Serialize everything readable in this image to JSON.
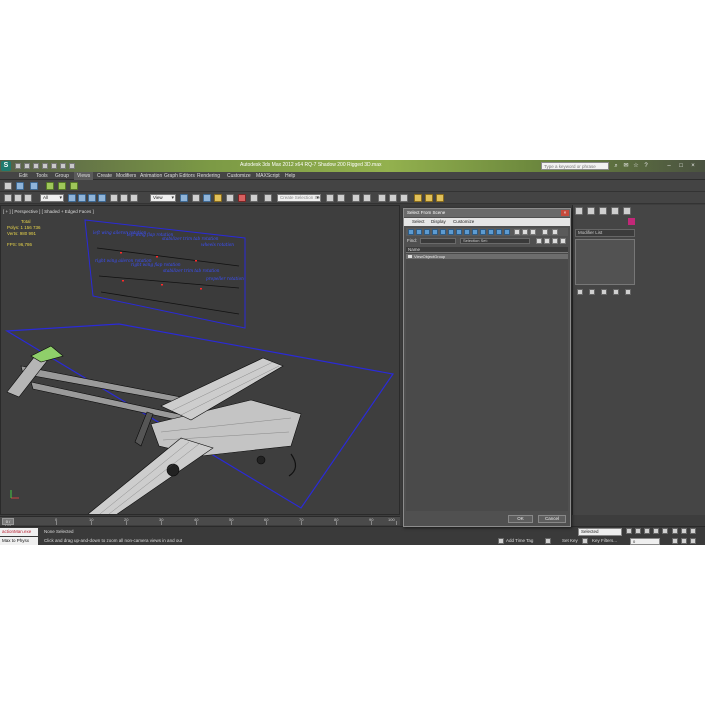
{
  "window": {
    "title": "Autodesk 3ds Max 2012 x64    RQ-7 Shadow 200 Rigged 3D.max",
    "help_search_placeholder": "Type a keyword or phrase"
  },
  "menu": {
    "items": [
      "Edit",
      "Tools",
      "Group",
      "Views",
      "Create",
      "Modifiers",
      "Animation",
      "Graph Editors",
      "Rendering",
      "Customize",
      "MAXScript",
      "Help"
    ]
  },
  "toolbar": {
    "filter_value": "All",
    "view_value": "View",
    "named_selection_placeholder": "Create Selection Se"
  },
  "viewport": {
    "label": "[ + ] [ Perspective ] [ Shaded + Edged Faces ]",
    "stats": {
      "total_label": "Total",
      "polys": "Polys:   1 156 736",
      "verts": "Verts:     980 991",
      "fps": "FPS:      96,786"
    },
    "signboard": [
      "left wing aileron rotation",
      "left wing flap rotation",
      "stabilizer trim tab rotation",
      "wheels rotation",
      "right wing aileron rotation",
      "right wing flap rotation",
      "stabilizer trim tab rotation",
      "propeller rotation"
    ]
  },
  "timeline": {
    "slider": "0 / 100",
    "ticks": [
      "0",
      "10",
      "20",
      "30",
      "40",
      "50",
      "60",
      "70",
      "80",
      "90",
      "100"
    ]
  },
  "status": {
    "listener_top": "actionMan.exe",
    "listener_bottom": "Max to Physx",
    "selection": "None Selected",
    "prompt": "Click and drag up-and-down to zoom all non-camera views in and out",
    "add_time_tag": "Add Time Tag",
    "set_key": "Set Key",
    "selected": "Selected",
    "key_filters": "Key Filters...",
    "frame": "0"
  },
  "command_panel": {
    "modifier_list": "Modifier List"
  },
  "dialog": {
    "title": "Select From Scene",
    "close": "×",
    "menu": [
      "Select",
      "Display",
      "Customize"
    ],
    "find_label": "Find:",
    "selection_set": "Selection Set:",
    "column_name": "Name",
    "rows": [
      "ViewObjectGroup"
    ],
    "ok_label": "OK",
    "cancel_label": "Cancel"
  },
  "colors": {
    "accent_green": "#93b14e",
    "selection_pink": "#c22878",
    "sign_text_blue": "#3b4fff"
  }
}
